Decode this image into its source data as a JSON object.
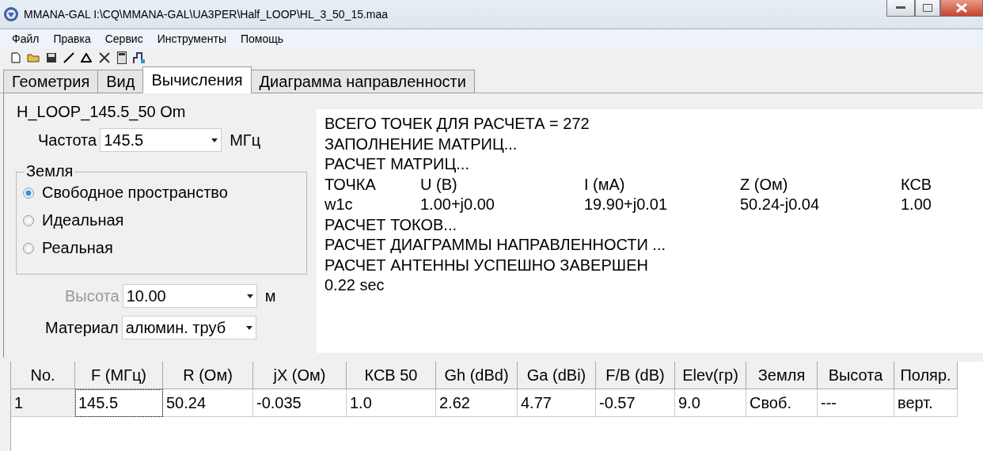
{
  "window": {
    "title": "MMANA-GAL I:\\CQ\\MMANA-GAL\\UA3PER\\Half_LOOP\\HL_3_50_15.maa"
  },
  "menu": [
    "Файл",
    "Правка",
    "Сервис",
    "Инструменты",
    "Помощь"
  ],
  "tabs": [
    {
      "label": "Геометрия",
      "selected": false
    },
    {
      "label": "Вид",
      "selected": false
    },
    {
      "label": "Вычисления",
      "selected": true
    },
    {
      "label": "Диаграмма направленности",
      "selected": false
    }
  ],
  "antenna_name": "H_LOOP_145.5_50 Om",
  "frequency": {
    "label": "Частота",
    "value": "145.5",
    "unit": "МГц"
  },
  "ground": {
    "title": "Земля",
    "options": [
      {
        "label": "Свободное пространство",
        "selected": true
      },
      {
        "label": "Идеальная",
        "selected": false
      },
      {
        "label": "Реальная",
        "selected": false
      }
    ]
  },
  "height": {
    "label": "Высота",
    "value": "10.00",
    "unit": "м",
    "disabled": true
  },
  "material": {
    "label": "Материал",
    "value": "алюмин. труб"
  },
  "output": [
    {
      "kind": "text",
      "text": "ВСЕГО ТОЧЕК ДЛЯ РАСЧЕТА = 272"
    },
    {
      "kind": "text",
      "text": "ЗАПОЛНЕНИЕ МАТРИЦ..."
    },
    {
      "kind": "text",
      "text": "РАСЧЕТ МАТРИЦ..."
    },
    {
      "kind": "columns",
      "cells": [
        "ТОЧКА",
        "U (В)",
        "I (мА)",
        "Z (Ом)",
        "КСВ"
      ]
    },
    {
      "kind": "columns",
      "cells": [
        "w1c",
        "1.00+j0.00",
        "19.90+j0.01",
        "50.24-j0.04",
        "1.00"
      ]
    },
    {
      "kind": "text",
      "text": "РАСЧЕТ ТОКОВ..."
    },
    {
      "kind": "text",
      "text": "РАСЧЕТ ДИАГРАММЫ НАПРАВЛЕННОСТИ ..."
    },
    {
      "kind": "text",
      "text": "РАСЧЕТ АНТЕННЫ УСПЕШНО ЗАВЕРШЕН"
    },
    {
      "kind": "text",
      "text": "0.22 sec"
    }
  ],
  "table": {
    "columns": [
      "No.",
      "F (МГц)",
      "R (Ом)",
      "jX (Ом)",
      "КСВ 50",
      "Gh (dBd)",
      "Ga (dBi)",
      "F/B (dB)",
      "Elev(гр)",
      "Земля",
      "Высота",
      "Поляр."
    ],
    "rows": [
      [
        "1",
        "145.5",
        "50.24",
        "-0.035",
        "1.0",
        "2.62",
        "4.77",
        "-0.57",
        "9.0",
        "Своб.",
        "---",
        "верт."
      ]
    ]
  }
}
